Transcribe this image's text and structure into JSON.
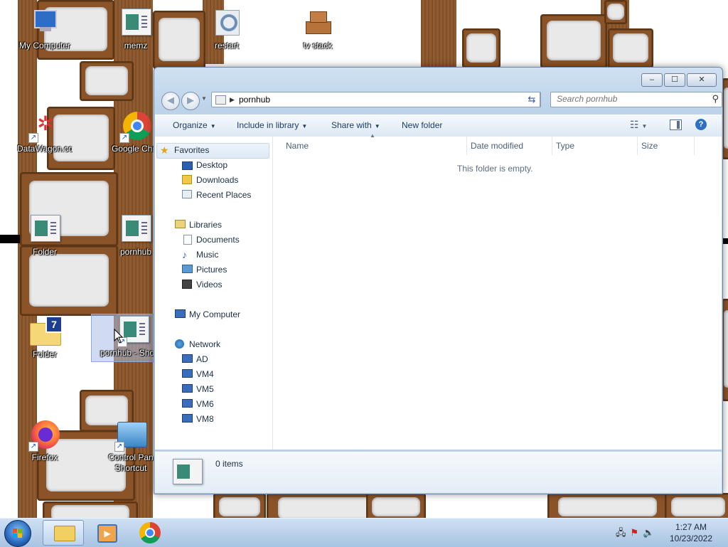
{
  "desktop": {
    "icons": [
      {
        "label": "My Computer"
      },
      {
        "label": "memz"
      },
      {
        "label": "restart"
      },
      {
        "label": "tv stack"
      },
      {
        "label": "DataWagon.com"
      },
      {
        "label": "Google Chro"
      },
      {
        "label": "Folder"
      },
      {
        "label": "pornhub"
      },
      {
        "label": "Folder"
      },
      {
        "label": "pornhub - Sho"
      },
      {
        "label": "Firefox"
      },
      {
        "label": "Control Pan",
        "label2": "Shortcut"
      }
    ]
  },
  "explorer": {
    "window_controls": {
      "minimize": "–",
      "maximize": "☐",
      "close": "✕"
    },
    "address": {
      "path": "pornhub"
    },
    "search": {
      "placeholder": "Search pornhub"
    },
    "toolbar": {
      "organize": "Organize",
      "include_in_library": "Include in library",
      "share_with": "Share with",
      "new_folder": "New folder"
    },
    "nav": {
      "favorites": {
        "label": "Favorites",
        "items": [
          "Desktop",
          "Downloads",
          "Recent Places"
        ]
      },
      "libraries": {
        "label": "Libraries",
        "items": [
          "Documents",
          "Music",
          "Pictures",
          "Videos"
        ]
      },
      "computer": {
        "label": "My Computer"
      },
      "network": {
        "label": "Network",
        "items": [
          "AD",
          "VM4",
          "VM5",
          "VM6",
          "VM8"
        ]
      }
    },
    "columns": [
      "Name",
      "Date modified",
      "Type",
      "Size"
    ],
    "empty_message": "This folder is empty.",
    "status": {
      "items_count": "0 items"
    }
  },
  "taskbar": {
    "clock": {
      "time": "1:27 AM",
      "date": "10/23/2022"
    }
  },
  "colors": {
    "accent": "#2f6fc2",
    "window_frame": "#bcd3ea",
    "wood": "#8a5428"
  }
}
